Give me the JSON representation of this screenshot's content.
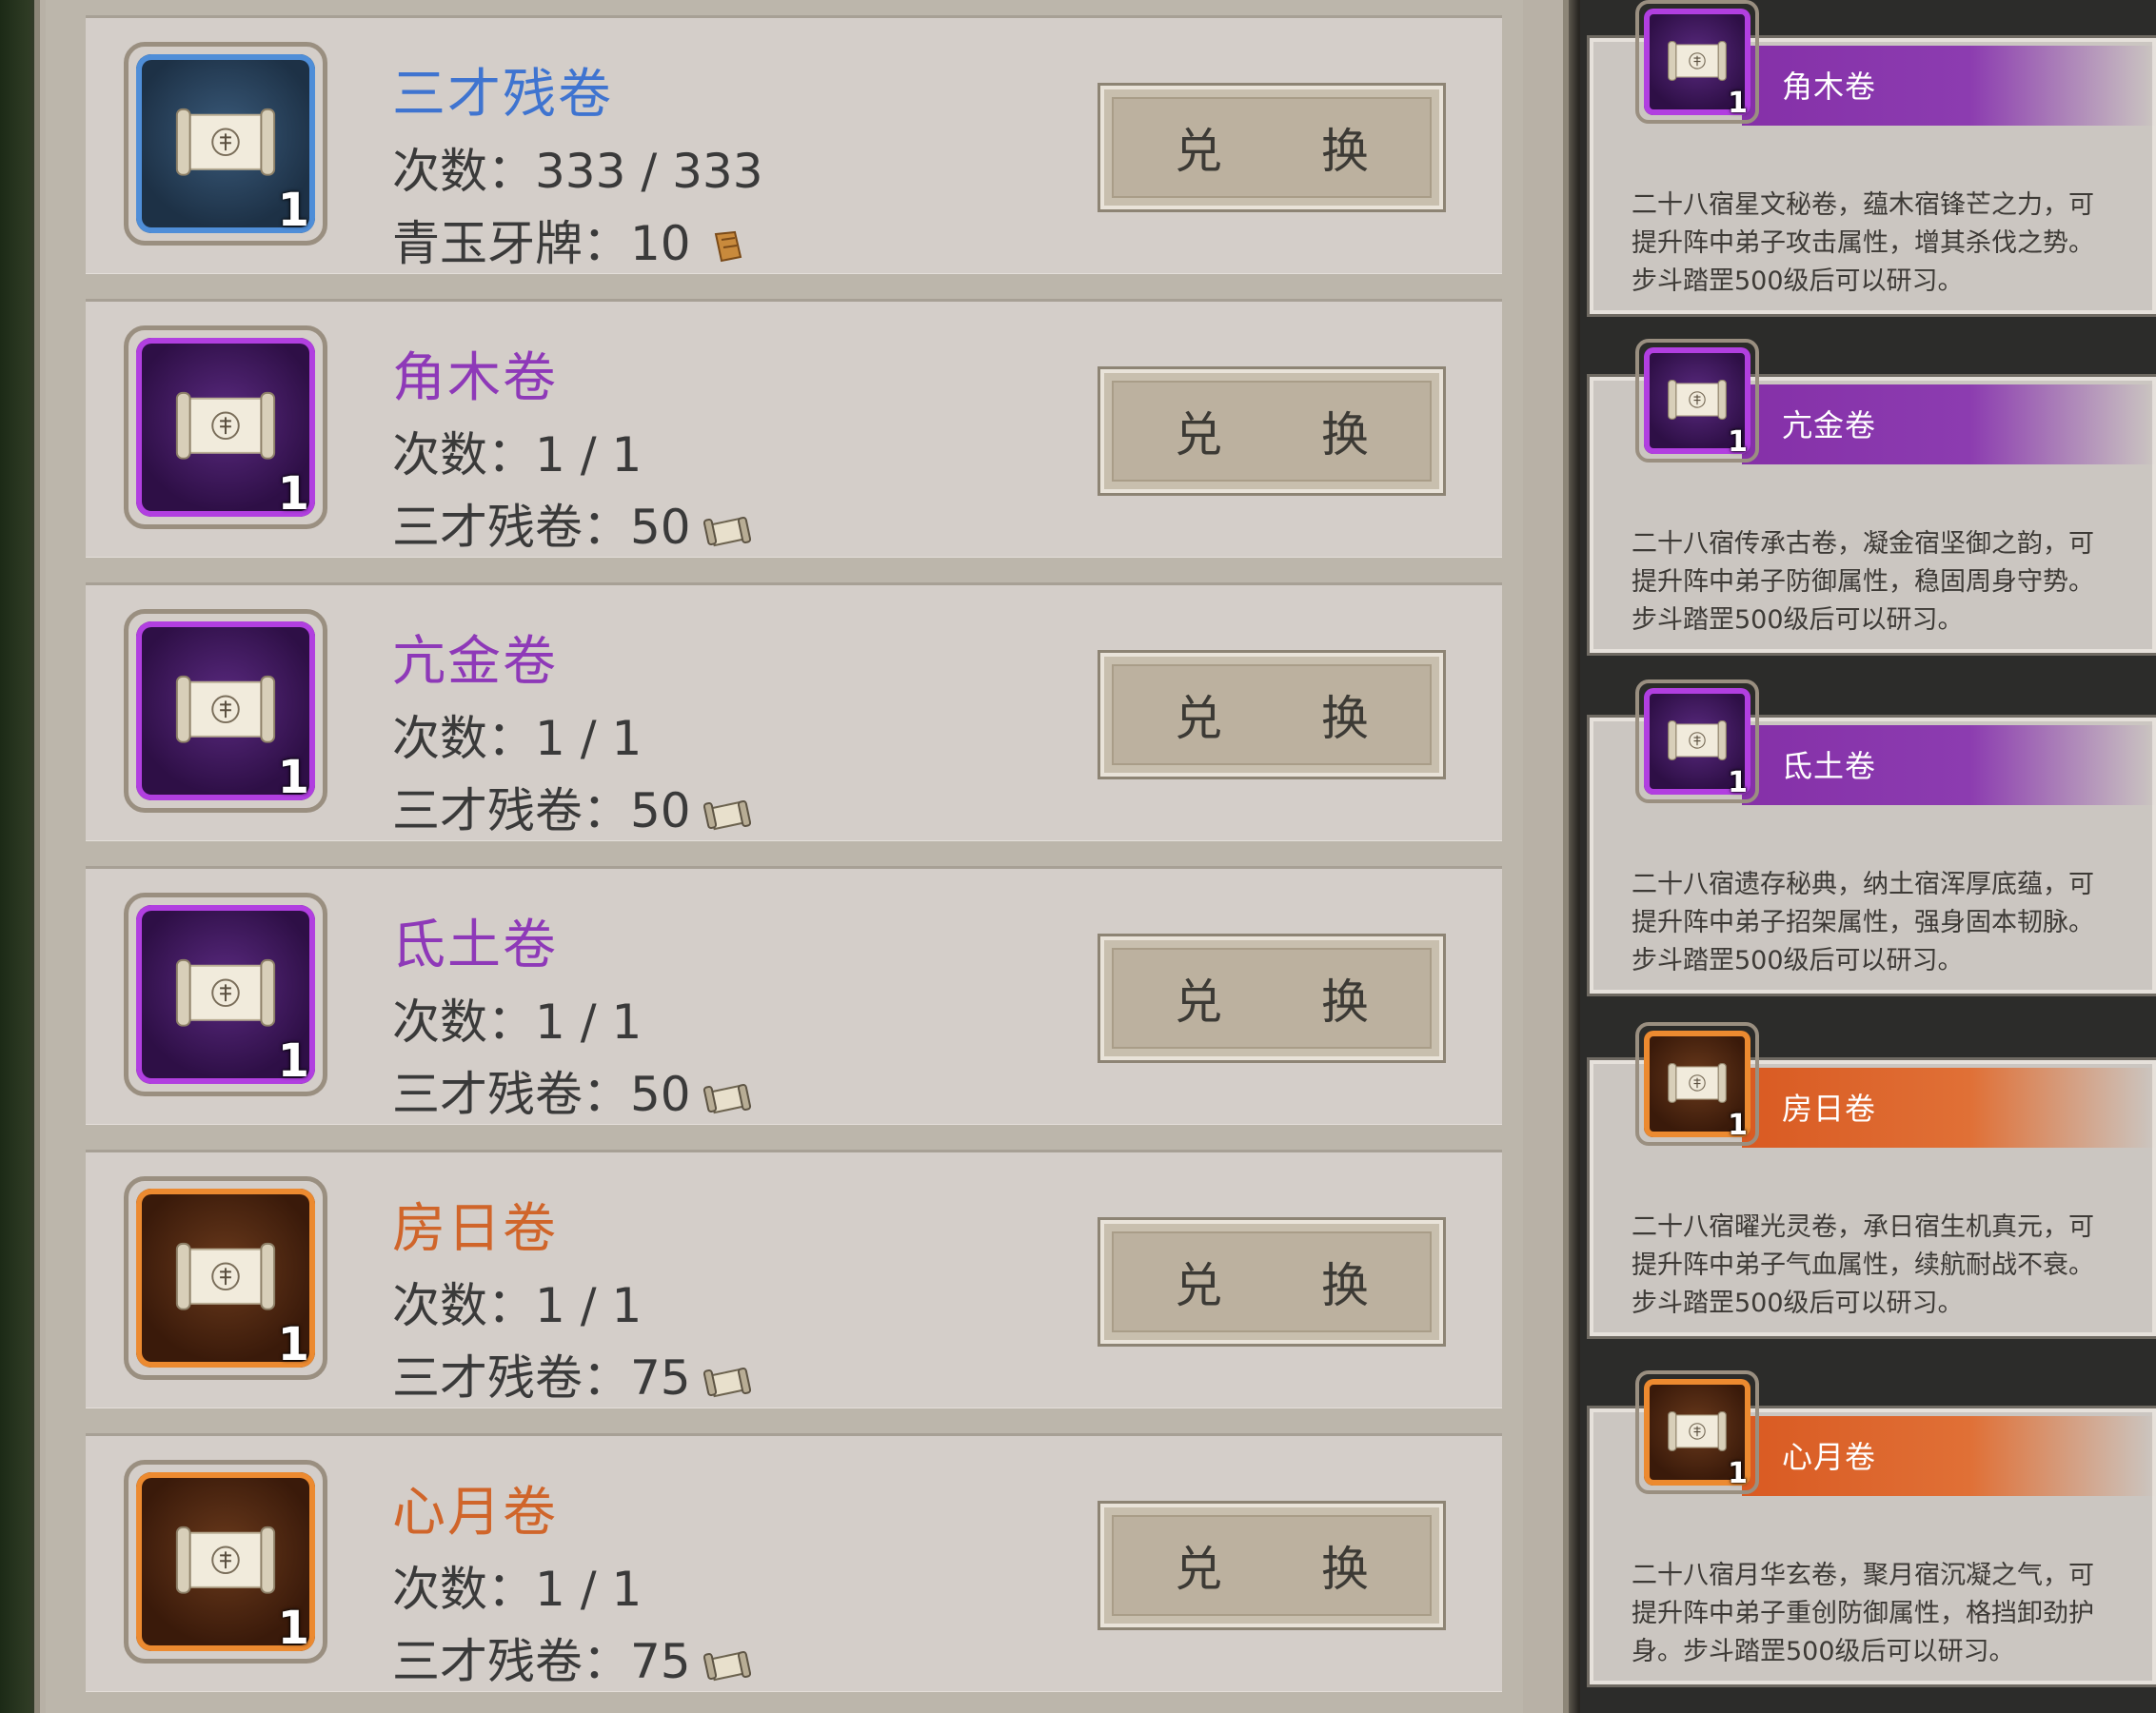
{
  "exchange_button_label": "兑 换",
  "items": [
    {
      "name": "三才残卷",
      "quality": "blue",
      "count": "1",
      "times": "次数：333 / 333",
      "cost": "青玉牙牌：10",
      "cost_icon": "jade-token-icon"
    },
    {
      "name": "角木卷",
      "quality": "purple",
      "count": "1",
      "times": "次数：1 / 1",
      "cost": "三才残卷：50",
      "cost_icon": "scroll-fragment-icon"
    },
    {
      "name": "亢金卷",
      "quality": "purple",
      "count": "1",
      "times": "次数：1 / 1",
      "cost": "三才残卷：50",
      "cost_icon": "scroll-fragment-icon"
    },
    {
      "name": "氐土卷",
      "quality": "purple",
      "count": "1",
      "times": "次数：1 / 1",
      "cost": "三才残卷：50",
      "cost_icon": "scroll-fragment-icon"
    },
    {
      "name": "房日卷",
      "quality": "orange",
      "count": "1",
      "times": "次数：1 / 1",
      "cost": "三才残卷：75",
      "cost_icon": "scroll-fragment-icon"
    },
    {
      "name": "心月卷",
      "quality": "orange",
      "count": "1",
      "times": "次数：1 / 1",
      "cost": "三才残卷：75",
      "cost_icon": "scroll-fragment-icon"
    }
  ],
  "cards": [
    {
      "name": "角木卷",
      "quality": "purple",
      "count": "1",
      "desc_lines": [
        "二十八宿星文秘卷，蕴木宿锋芒之力，可",
        "提升阵中弟子攻击属性，增其杀伐之势。",
        "步斗踏罡500级后可以研习。"
      ]
    },
    {
      "name": "亢金卷",
      "quality": "purple",
      "count": "1",
      "desc_lines": [
        "二十八宿传承古卷，凝金宿坚御之韵，可",
        "提升阵中弟子防御属性，稳固周身守势。",
        "步斗踏罡500级后可以研习。"
      ]
    },
    {
      "name": "氐土卷",
      "quality": "purple",
      "count": "1",
      "desc_lines": [
        "二十八宿遗存秘典，纳土宿浑厚底蕴，可",
        "提升阵中弟子招架属性，强身固本韧脉。",
        "步斗踏罡500级后可以研习。"
      ]
    },
    {
      "name": "房日卷",
      "quality": "orange",
      "count": "1",
      "desc_lines": [
        "二十八宿曜光灵卷，承日宿生机真元，可",
        "提升阵中弟子气血属性，续航耐战不衰。",
        "步斗踏罡500级后可以研习。"
      ]
    },
    {
      "name": "心月卷",
      "quality": "orange",
      "count": "1",
      "desc_lines": [
        "二十八宿月华玄卷，聚月宿沉凝之气，可",
        "提升阵中弟子重创防御属性，格挡卸劲护",
        "身。步斗踏罡500级后可以研习。"
      ]
    }
  ],
  "colors": {
    "blue": "#4f8ed8",
    "purple": "#b13fe0",
    "orange": "#ec8a30"
  }
}
